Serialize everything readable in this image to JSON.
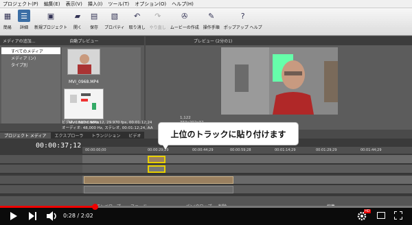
{
  "menu": [
    "プロジェクト(P)",
    "編集(E)",
    "表示(V)",
    "挿入(I)",
    "ツール(T)",
    "オプション(O)",
    "ヘルプ(H)"
  ],
  "toolbar": [
    {
      "label": "簡易",
      "icon": "grid-icon"
    },
    {
      "label": "詳細",
      "icon": "list-icon"
    },
    {
      "label": "新規プロジェクト",
      "icon": "new-project-icon"
    },
    {
      "label": "開く",
      "icon": "folder-icon"
    },
    {
      "label": "保存",
      "icon": "save-icon"
    },
    {
      "label": "プロパティ",
      "icon": "properties-icon"
    },
    {
      "label": "取り消し",
      "icon": "undo-icon"
    },
    {
      "label": "やり直し",
      "icon": "redo-icon"
    },
    {
      "label": "ムービーの作成",
      "icon": "film-reel-icon"
    },
    {
      "label": "操作手順",
      "icon": "help-icon"
    },
    {
      "label": "ポップアップ ヘルプ",
      "icon": "popup-help-icon"
    }
  ],
  "media_panel": {
    "header": "メディアの追加...",
    "auto_preview": "自動プレビュー",
    "tree": [
      "すべてのメディア",
      "メディア (ン)",
      "タイプ別"
    ],
    "thumbs": [
      "MVI_0968.MP4",
      "MVI_0971.MP4"
    ],
    "info_line1": "ビデオ: 1920x1080x12, 29.970 fps, 00:01:12;24",
    "info_line2": "オーディオ: 48,000 Hz, ステレオ, 00:01:12;24, AA"
  },
  "preview": {
    "header": "プレビュー (2分の1)",
    "resolution": "359x202x32",
    "frame": "1,122"
  },
  "tabs": [
    "プロジェクト メディア",
    "エクスプローラ",
    "トランジション",
    "ビデオ"
  ],
  "timeline": {
    "timecode": "00:00:37;12",
    "ruler": [
      "00:00:00;00",
      "00:00:29;29",
      "00:00:44;29",
      "00:00:59;28",
      "00:01:14;29",
      "00:01:29;29",
      "00:01:44;29"
    ],
    "tooltip": "上位のトラックに貼り付けます"
  },
  "edit_tools": [
    "エンベロープ",
    "フェード",
    "パン/クロップ",
    "削除",
    "編集"
  ],
  "youtube": {
    "time": "0:28 / 2:02",
    "progress": 0.23,
    "hd_badge": "HD"
  }
}
